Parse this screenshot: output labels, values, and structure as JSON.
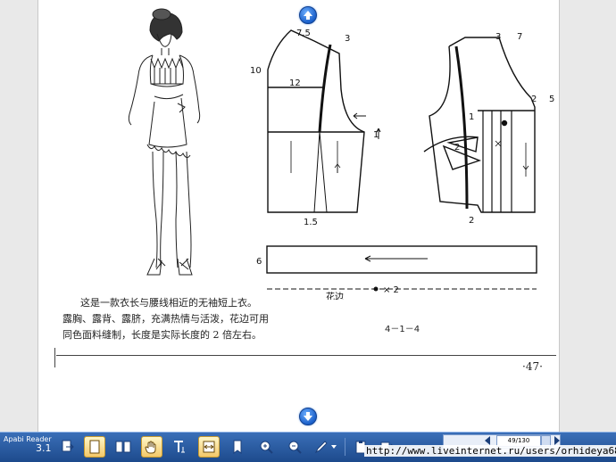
{
  "app": {
    "name": "Apabi Reader",
    "version": "3.1"
  },
  "page": {
    "caption_lines": [
      "这是一款衣长与腰线相近的无袖短上衣。",
      "露胸、露背、露脐，充满热情与活泼，花边可用",
      "同色面料缝制，长度是实际长度的 2 倍左右。"
    ],
    "figure_number": "4－1－4",
    "page_number": "·47·"
  },
  "diagram": {
    "front_labels": [
      "7.5",
      "3",
      "10",
      "12",
      "1",
      "1.5"
    ],
    "back_labels": [
      "3",
      "7",
      "9",
      "1",
      "3",
      "2",
      "5",
      "2",
      "2",
      "2"
    ],
    "ruffle_height": "6",
    "ruffle_label": "花边",
    "ruffle_multiplier": "× 2"
  },
  "toolbar": {
    "page_indicator": "49/130",
    "icons": [
      "convert-icon",
      "page-icon",
      "single-page-icon",
      "double-page-icon",
      "hand-icon",
      "text-select-icon",
      "fit-width-icon",
      "bookmark-icon",
      "zoom-in-icon",
      "zoom-out-icon",
      "pen-icon",
      "dropdown-icon",
      "clipboard-icon",
      "export-icon"
    ]
  },
  "overlay": {
    "url": "http://www.liveinternet.ru/users/orhideya6868/"
  },
  "colors": {
    "taskbar": "#2a5aa0",
    "active": "#f3c86a",
    "nav_arrow": "#1a5fc9"
  }
}
